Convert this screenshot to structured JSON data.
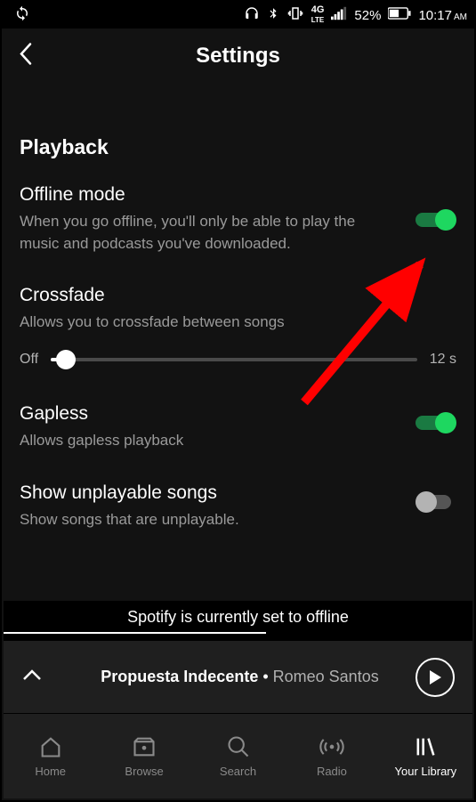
{
  "statusbar": {
    "battery": "52%",
    "time": "10:17",
    "ampm": "AM",
    "network": "4G LTE"
  },
  "header": {
    "title": "Settings"
  },
  "section": {
    "title": "Playback"
  },
  "settings": {
    "offline": {
      "title": "Offline mode",
      "desc": "When you go offline, you'll only be able to play the music and podcasts you've downloaded.",
      "on": true
    },
    "crossfade": {
      "title": "Crossfade",
      "desc": "Allows you to crossfade between songs",
      "min_label": "Off",
      "max_label": "12 s",
      "value": 0
    },
    "gapless": {
      "title": "Gapless",
      "desc": "Allows gapless playback",
      "on": true
    },
    "unplayable": {
      "title": "Show unplayable songs",
      "desc": "Show songs that are unplayable.",
      "on": false
    }
  },
  "toast": {
    "text": "Spotify is currently set to offline"
  },
  "nowplaying": {
    "track": "Propuesta Indecente",
    "separator": " • ",
    "artist": "Romeo Santos"
  },
  "nav": {
    "home": "Home",
    "browse": "Browse",
    "search": "Search",
    "radio": "Radio",
    "library": "Your Library"
  }
}
